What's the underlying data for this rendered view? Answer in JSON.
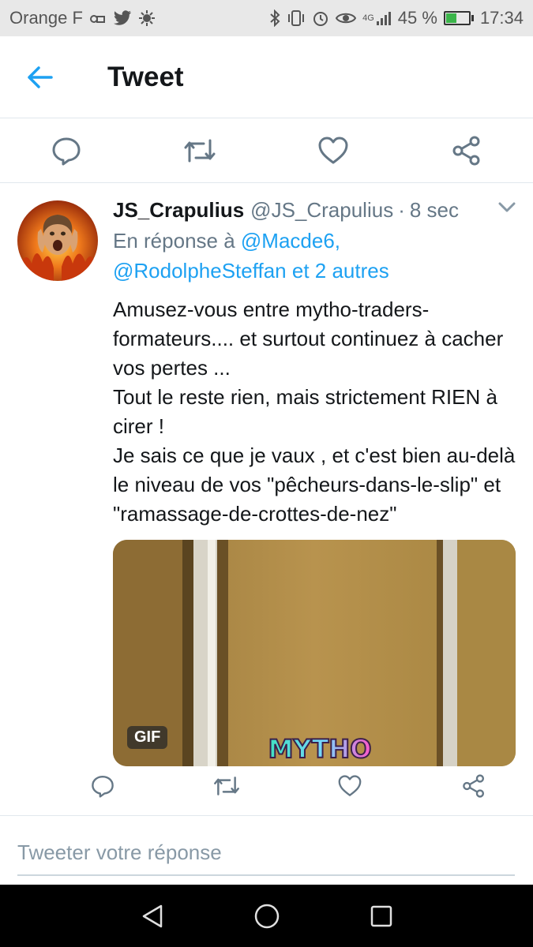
{
  "status_bar": {
    "carrier": "Orange F",
    "network": "4G",
    "battery": "45 %",
    "battery_level": 0.45,
    "time": "17:34"
  },
  "header": {
    "title": "Tweet"
  },
  "tweet": {
    "display_name": "JS_Crapulius",
    "handle": "@JS_Crapulius",
    "separator": "·",
    "timestamp": "8 sec",
    "reply_prefix": "En réponse à",
    "reply_user_1": "@Macde6,",
    "reply_user_2": "@RodolpheSteffan et 2 autres",
    "text_lines": [
      "Amusez-vous entre mytho-traders-formateurs.... et surtout continuez à cacher vos pertes ...",
      "Tout le reste rien, mais strictement RIEN à cirer !",
      "Je sais ce que je vaux , et c'est bien au-delà le niveau de vos \"pêcheurs-dans-le-slip\" et \"ramassage-de-crottes-de-nez\""
    ],
    "media": {
      "badge": "GIF",
      "caption": "MYTHO"
    }
  },
  "reply": {
    "placeholder": "Tweeter votre réponse",
    "value": ""
  },
  "colors": {
    "accent": "#1da1f2",
    "text_primary": "#14171a",
    "text_secondary": "#657786",
    "divider": "#e1e8ed"
  },
  "icons": {
    "top_actions": [
      "reply-icon",
      "retweet-icon",
      "like-icon",
      "share-icon"
    ],
    "nav": [
      "back-triangle-icon",
      "home-circle-icon",
      "recents-square-icon"
    ]
  }
}
